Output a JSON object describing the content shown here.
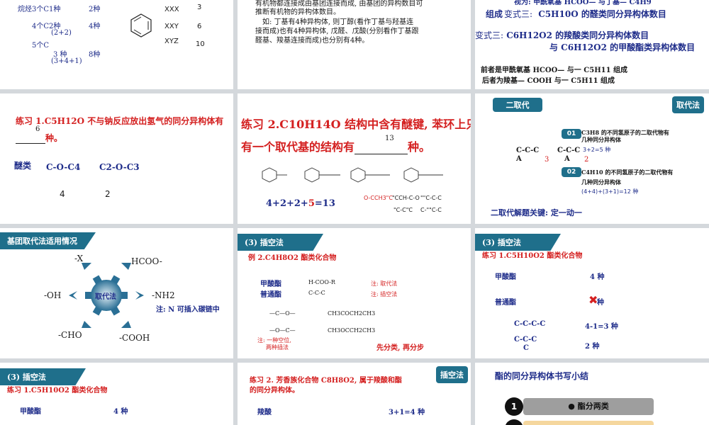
{
  "s1": {
    "l1": "烷烃3个C1种",
    "l1b": "2种",
    "l2": "4个C2种",
    "l2b": "4种",
    "l2c": "(2+2)",
    "l3": "5个C",
    "l3b": "3 种",
    "l3c": "8种",
    "l3d": "(3+4+1)",
    "xxx": "XXX",
    "xxx_n": "3",
    "xxy": "XXY",
    "xxy_n": "6",
    "xyz": "XYZ",
    "xyz_n": "10"
  },
  "s2": {
    "p1": "有机物都连接成由基团连接而成, 由基团的异构数目可",
    "p2": "推断有机物的异构体数目。",
    "p3": "如: 丁基有4种异构体, 则丁醇(看作丁基与羟基连",
    "p4": "接而成)也有4种异构体, 戊醛、戊酸(分别看作丁基跟",
    "p5": "醛基、羧基连接而成)也分别有4种。"
  },
  "s3": {
    "top": "视为: 甲酰氧基 HCOO— 与丁基— C4H9",
    "t3a": "组成",
    "t3b": "变式三:",
    "t3c": "C5H10O 的醛类同分异构体数目",
    "f3a": "变式三:",
    "f3b": "C6H12O2 的羧酸类同分异构体数目",
    "f3c": "与 C6H12O2 的甲酸酯类异构体数目",
    "n1": "前者是甲酰氧基 HCOO— 与一 C5H11 组成",
    "n2": "后者为羧基— COOH 与一 C5H11 组成"
  },
  "s4": {
    "q": "练习 1.C5H12O 不与钠反应放出氢气的同分异构体有",
    "ans": "6",
    "q2": "种。",
    "ether": "醚类",
    "c1": "C-O-C4",
    "c2": "C2-O-C3",
    "n1": "4",
    "n2": "2"
  },
  "s5": {
    "q1": "练习 2.C10H14O 结构中含有醚键, 苯环上只",
    "q2": "有一个取代基的结构有",
    "ans": "13",
    "q3": "种。",
    "sum_a": "4+2+2+",
    "sum_b": "5",
    "sum_c": "=13",
    "m1": "O-CCH3\"C",
    "m2": "\"CCH-C-O",
    "m3": "\"\"C-C-C",
    "m4": "\"C-C\"C",
    "m5": "C-\"\"C-C"
  },
  "s6": {
    "tag": "二取代",
    "badge": "取代法",
    "b1": "01",
    "t1a": "C3H8 的不同氢原子的二取代物有",
    "t1b": "几种同分异构体",
    "t1c": "3+2=5 种",
    "b2": "02",
    "t2a": "C4H10 的不同氢原子的二取代物有",
    "t2b": "几种同分异构体",
    "t2c": "(4+4)+(3+1)=12 种",
    "ccc1": "C-C-C",
    "a1": "A",
    "n3": "3",
    "ccc2": "C-C-C",
    "a2": "A",
    "n2": "2",
    "key": "二取代解题关键: 定一动一"
  },
  "s7": {
    "tag": "基团取代法适用情况",
    "center": "取代法",
    "g1": "-X",
    "g2": "HCOO-",
    "g3": "-OH",
    "g4": "-NH2",
    "g5": "-CHO",
    "g6": "-COOH",
    "note": "注: N 可插入碳链中"
  },
  "s8": {
    "tag": "(3) 插空法",
    "ex": "例 2.C4H8O2 酯类化合物",
    "r1": "甲酸酯",
    "r1b": "H-COO-R",
    "r1c": "注: 取代法",
    "r2": "普通酯",
    "r2b": "C-C-C",
    "r2c": "注: 插空法",
    "f1": "—C—O—",
    "f2": "CH3COCH2CH3",
    "f3": "—O—C—",
    "f4": "CH3OCCH2CH3",
    "nt1": "注: 一种空位,",
    "nt2": "两种插法",
    "fin": "先分类, 再分步"
  },
  "s9": {
    "tag": "(3) 插空法",
    "q": "练习 1.C5H10O2 酯类化合物",
    "r1": "甲酸酯",
    "r1b": "4 种",
    "r2": "普通酯",
    "r2b": "种",
    "c1": "C-C-C-C",
    "c1b": "4-1=3 种",
    "c2": "C-C-C",
    "c2c": "C",
    "c2b": "2 种"
  },
  "s10": {
    "tag": "(3) 插空法",
    "q": "练习 1.C5H10O2 酯类化合物",
    "r1": "甲酸酯",
    "r1b": "4 种"
  },
  "s11": {
    "q1": "练习 2. 芳香族化合物 C8H8O2, 属于羧酸和酯",
    "q2": "的同分异构体。",
    "badge": "插空法",
    "r1": "羧酸",
    "r1b": "3+1=4 种"
  },
  "s12": {
    "title": "酯的同分异构体书写小结",
    "n1": "1",
    "item1": "● 酯分两类",
    "n2": "2"
  },
  "colors": {
    "accent": "#1f6f8b",
    "red": "#d42020",
    "navy": "#1f2d8a"
  }
}
